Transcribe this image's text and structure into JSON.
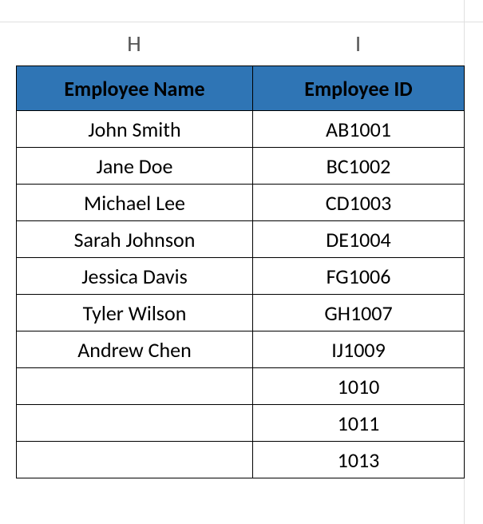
{
  "chart_data": {
    "type": "table",
    "columns": [
      "Employee Name",
      "Employee ID"
    ],
    "rows": [
      [
        "John Smith",
        "AB1001"
      ],
      [
        "Jane Doe",
        "BC1002"
      ],
      [
        "Michael Lee",
        "CD1003"
      ],
      [
        "Sarah Johnson",
        "DE1004"
      ],
      [
        "Jessica Davis",
        "FG1006"
      ],
      [
        "Tyler Wilson",
        "GH1007"
      ],
      [
        "Andrew Chen",
        "IJ1009"
      ],
      [
        "",
        "1010"
      ],
      [
        "",
        "1011"
      ],
      [
        "",
        "1013"
      ]
    ]
  },
  "column_letters": {
    "h": "H",
    "i": "I"
  },
  "headers": {
    "name": "Employee Name",
    "id": "Employee ID"
  },
  "rows": [
    {
      "name": "John Smith",
      "id": "AB1001"
    },
    {
      "name": "Jane Doe",
      "id": "BC1002"
    },
    {
      "name": "Michael Lee",
      "id": "CD1003"
    },
    {
      "name": "Sarah Johnson",
      "id": "DE1004"
    },
    {
      "name": "Jessica Davis",
      "id": "FG1006"
    },
    {
      "name": "Tyler Wilson",
      "id": "GH1007"
    },
    {
      "name": "Andrew Chen",
      "id": "IJ1009"
    },
    {
      "name": "",
      "id": "1010"
    },
    {
      "name": "",
      "id": "1011"
    },
    {
      "name": "",
      "id": "1013"
    }
  ]
}
